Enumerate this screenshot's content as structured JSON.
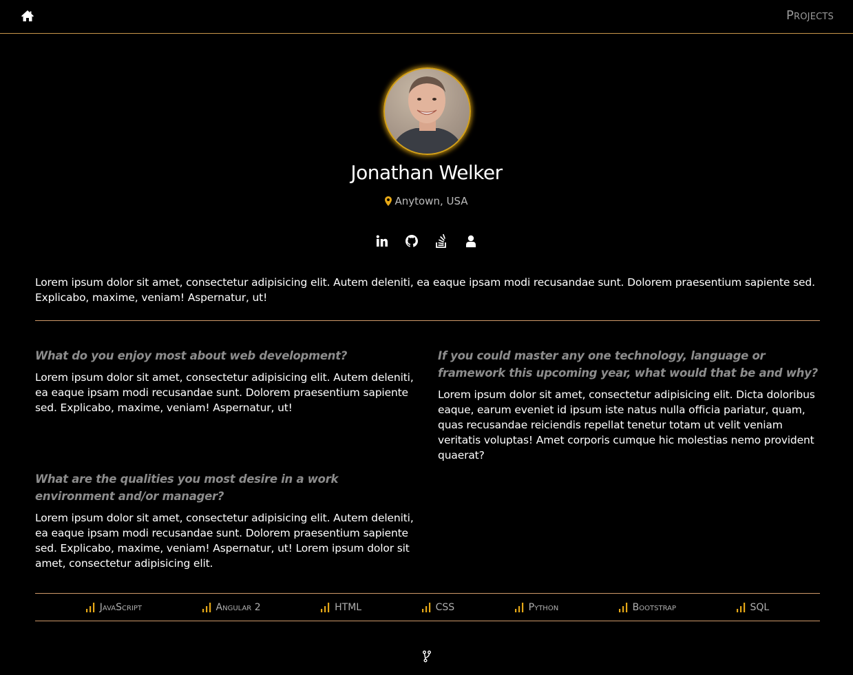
{
  "nav": {
    "home_icon": "home-icon",
    "projects_label": "Projects"
  },
  "profile": {
    "name": "Jonathan Welker",
    "location": "Anytown, USA",
    "location_icon": "map-marker-icon",
    "social_icons": [
      "linkedin-icon",
      "github-icon",
      "stackoverflow-icon",
      "user-icon"
    ]
  },
  "intro": "Lorem ipsum dolor sit amet, consectetur adipisicing elit. Autem deleniti, ea eaque ipsam modi recusandae sunt. Dolorem praesentium sapiente sed. Explicabo, maxime, veniam! Aspernatur, ut!",
  "qa": [
    {
      "question": "What do you enjoy most about web development?",
      "answer": "Lorem ipsum dolor sit amet, consectetur adipisicing elit. Autem deleniti, ea eaque ipsam modi recusandae sunt. Dolorem praesentium sapiente sed. Explicabo, maxime, veniam! Aspernatur, ut!"
    },
    {
      "question": "If you could master any one technology, language or framework this upcoming year, what would that be and why?",
      "answer": "Lorem ipsum dolor sit amet, consectetur adipisicing elit. Dicta doloribus eaque, earum eveniet id ipsum iste natus nulla officia pariatur, quam, quas recusandae reiciendis repellat tenetur totam ut velit veniam veritatis voluptas! Amet corporis cumque hic molestias nemo provident quaerat?"
    },
    {
      "question": "What are the qualities you most desire in a work environment and/or manager?",
      "answer": "Lorem ipsum dolor sit amet, consectetur adipisicing elit. Autem deleniti, ea eaque ipsam modi recusandae sunt. Dolorem praesentium sapiente sed. Explicabo, maxime, veniam! Aspernatur, ut! Lorem ipsum dolor sit amet, consectetur adipisicing elit."
    }
  ],
  "skills": [
    "JavaScript",
    "Angular 2",
    "HTML",
    "CSS",
    "Python",
    "Bootstrap",
    "SQL"
  ],
  "skill_icon": "signal-bars-icon",
  "footer_icon": "code-fork-icon",
  "colors": {
    "accent": "#d4a017",
    "rule": "#d09a6a",
    "muted": "#8c8c8c",
    "background": "#000000"
  }
}
